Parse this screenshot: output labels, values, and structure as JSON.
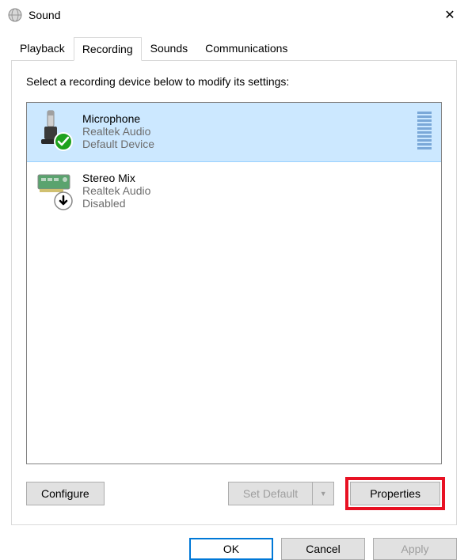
{
  "window": {
    "title": "Sound",
    "close_glyph": "✕"
  },
  "tabs": {
    "playback": "Playback",
    "recording": "Recording",
    "sounds": "Sounds",
    "communications": "Communications"
  },
  "intro": "Select a recording device below to modify its settings:",
  "devices": [
    {
      "name": "Microphone",
      "desc": "Realtek Audio",
      "status": "Default Device",
      "selected": true,
      "overlay": "check"
    },
    {
      "name": "Stereo Mix",
      "desc": "Realtek Audio",
      "status": "Disabled",
      "selected": false,
      "overlay": "down"
    }
  ],
  "buttons": {
    "configure": "Configure",
    "set_default": "Set Default",
    "properties": "Properties",
    "ok": "OK",
    "cancel": "Cancel",
    "apply": "Apply"
  },
  "dropdown_glyph": "▼",
  "states": {
    "set_default_enabled": false,
    "apply_enabled": false,
    "properties_highlighted": true
  }
}
